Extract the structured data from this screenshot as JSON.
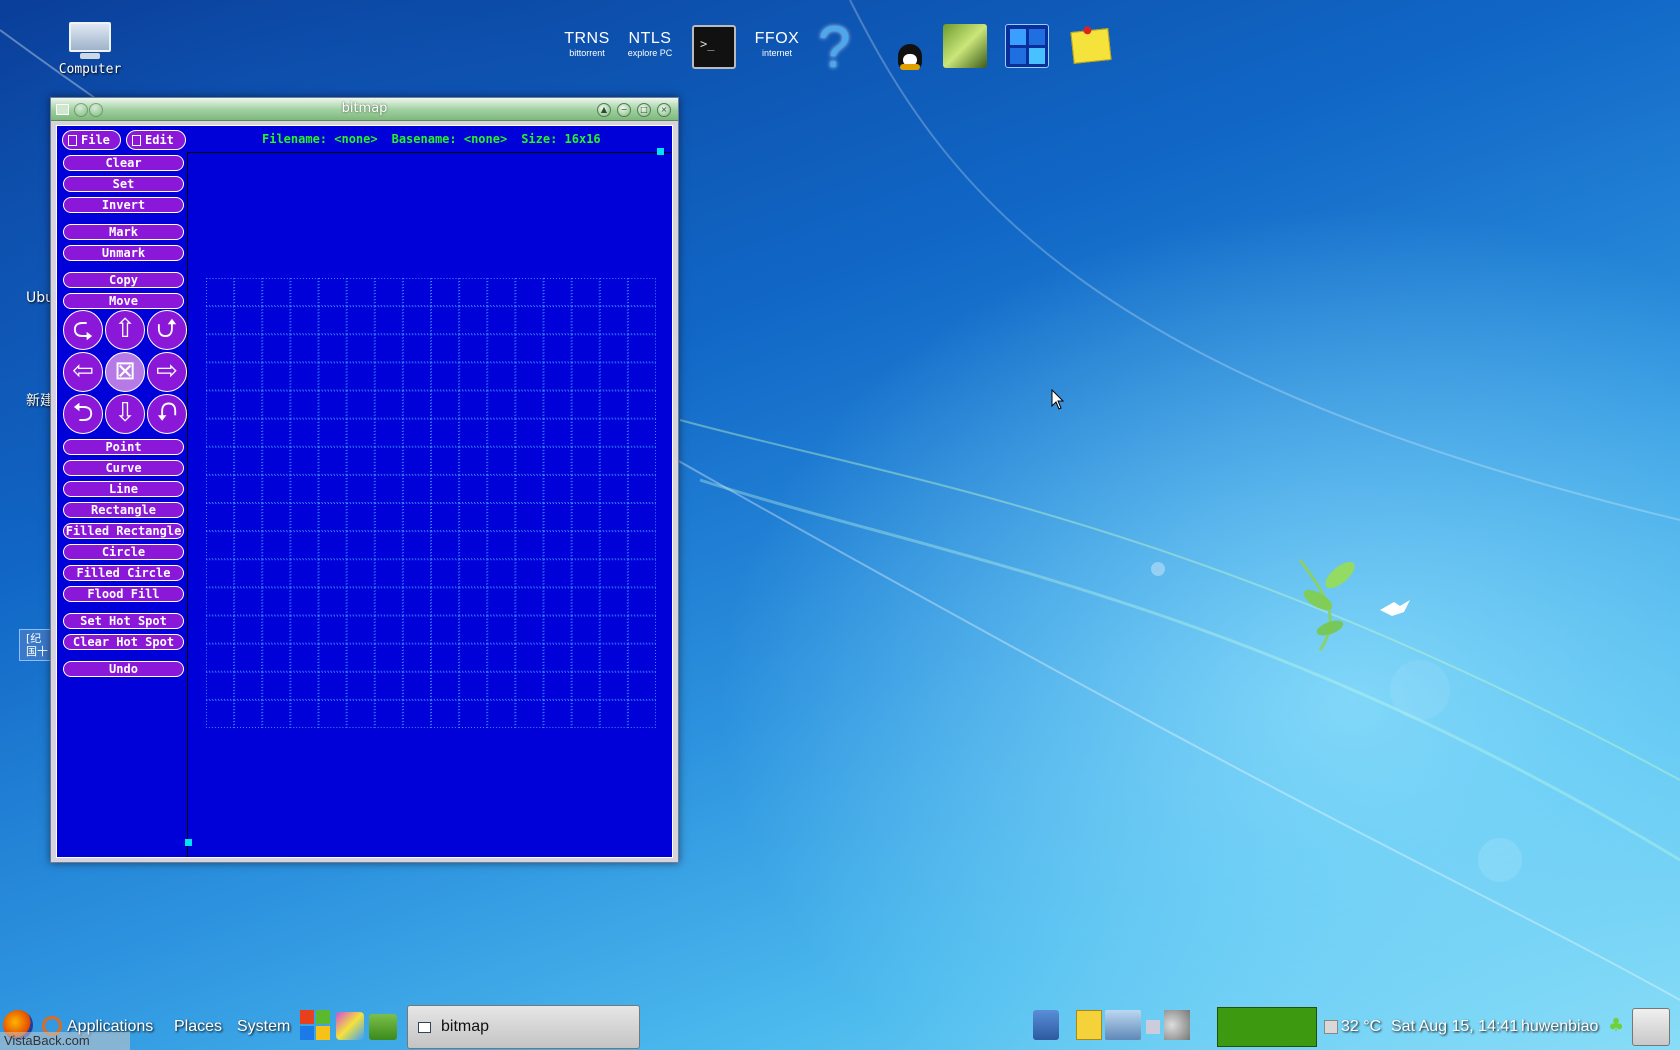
{
  "desktop": {
    "computer_label": "Computer",
    "side_labels": [
      "Ubu",
      "新建"
    ],
    "side_badge_lines": [
      "[纪",
      "国十"
    ]
  },
  "launcher": [
    {
      "big": "TRNS",
      "small": "bittorrent"
    },
    {
      "big": "NTLS",
      "small": "explore PC"
    },
    {
      "big": "FFOX",
      "small": "internet"
    }
  ],
  "window": {
    "title": "bitmap",
    "menus": {
      "file": "File",
      "edit": "Edit"
    },
    "status": {
      "filename": "Filename: <none>",
      "basename": "Basename: <none>",
      "size": "Size: 16x16"
    },
    "commands": {
      "clear": "Clear",
      "set": "Set",
      "invert": "Invert",
      "mark": "Mark",
      "unmark": "Unmark",
      "copy": "Copy",
      "move": "Move",
      "point": "Point",
      "curve": "Curve",
      "line": "Line",
      "rectangle": "Rectangle",
      "filled_rectangle": "Filled Rectangle",
      "circle": "Circle",
      "filled_circle": "Filled Circle",
      "flood_fill": "Flood Fill",
      "set_hot_spot": "Set Hot Spot",
      "clear_hot_spot": "Clear Hot Spot",
      "undo": "Undo"
    },
    "arrows": [
      "⮎",
      "⇧",
      "⮍",
      "⇦",
      "⊠",
      "⇨",
      "⮌",
      "⇩",
      "⮏"
    ],
    "grid": {
      "cols": 16,
      "rows": 16
    },
    "colors": {
      "background": "#0000d8",
      "button": "#8b18d8",
      "status_text": "#26f426",
      "grid_line": "#3a8cff"
    }
  },
  "panel": {
    "applications": "Applications",
    "places": "Places",
    "system": "System",
    "task_label": "bitmap",
    "temperature": "32 °C",
    "clock": "Sat Aug 15, 14:41",
    "user": "huwenbiao",
    "watermark": "VistaBack.com"
  }
}
